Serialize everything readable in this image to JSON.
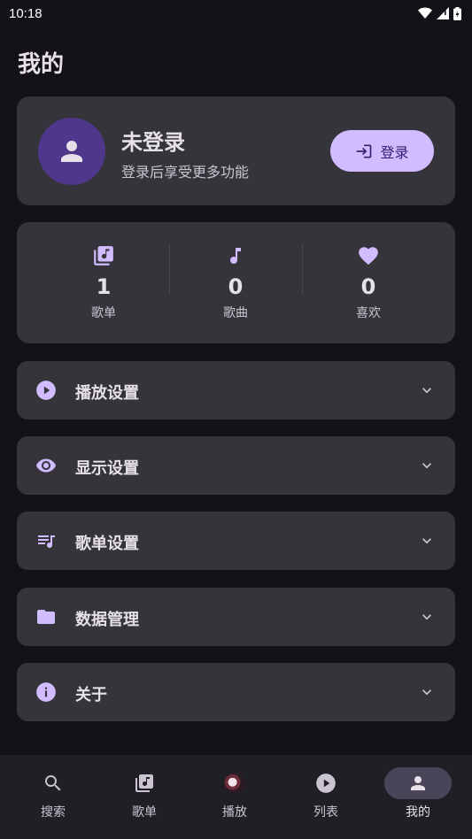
{
  "status_bar": {
    "time": "10:18"
  },
  "page": {
    "title": "我的"
  },
  "profile": {
    "name": "未登录",
    "subtitle": "登录后享受更多功能",
    "login_label": "登录"
  },
  "stats": [
    {
      "value": "1",
      "label": "歌单",
      "icon": "playlist-icon"
    },
    {
      "value": "0",
      "label": "歌曲",
      "icon": "music-note-icon"
    },
    {
      "value": "0",
      "label": "喜欢",
      "icon": "heart-icon"
    }
  ],
  "settings": [
    {
      "label": "播放设置",
      "icon": "play-circle-icon"
    },
    {
      "label": "显示设置",
      "icon": "eye-icon"
    },
    {
      "label": "歌单设置",
      "icon": "playlist-settings-icon"
    },
    {
      "label": "数据管理",
      "icon": "folder-icon"
    },
    {
      "label": "关于",
      "icon": "info-icon"
    }
  ],
  "nav": [
    {
      "label": "搜索",
      "icon": "search-icon"
    },
    {
      "label": "歌单",
      "icon": "playlist-icon"
    },
    {
      "label": "播放",
      "icon": "album-art"
    },
    {
      "label": "列表",
      "icon": "play-circle-icon"
    },
    {
      "label": "我的",
      "icon": "person-icon",
      "active": true
    }
  ],
  "colors": {
    "background": "#141218",
    "card": "#36343b",
    "accent": "#d0bcff",
    "avatar": "#4f378b",
    "nav_active": "#4a4458"
  }
}
